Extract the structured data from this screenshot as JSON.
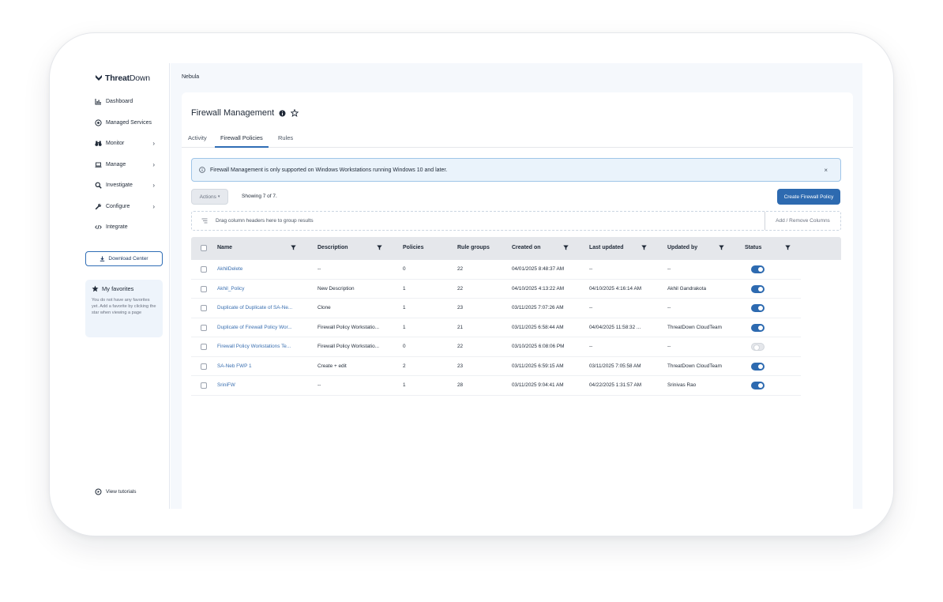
{
  "brand": {
    "name_bold": "Threat",
    "name_regular": "Down"
  },
  "sidebar": {
    "items": [
      {
        "label": "Dashboard",
        "icon": "bar-chart-icon",
        "has_chevron": false
      },
      {
        "label": "Managed Services",
        "icon": "target-icon",
        "has_chevron": false
      },
      {
        "label": "Monitor",
        "icon": "binoculars-icon",
        "has_chevron": true
      },
      {
        "label": "Manage",
        "icon": "laptop-icon",
        "has_chevron": true
      },
      {
        "label": "Investigate",
        "icon": "search-icon",
        "has_chevron": true
      },
      {
        "label": "Configure",
        "icon": "wrench-icon",
        "has_chevron": true
      },
      {
        "label": "Integrate",
        "icon": "code-icon",
        "has_chevron": false
      }
    ],
    "download_center": "Download Center",
    "favorites": {
      "title": "My favorites",
      "text": "You do not have any favorites yet. Add a favorite by clicking the star when viewing a page"
    },
    "view_tutorials": "View tutorials"
  },
  "breadcrumb": "Nebula",
  "page": {
    "title": "Firewall Management",
    "tabs": [
      "Activity",
      "Firewall Policies",
      "Rules"
    ],
    "active_tab": "Firewall Policies",
    "banner": "Firewall Management is only supported on Windows Workstations running Windows 10 and later.",
    "banner_close": "×",
    "actions_label": "Actions",
    "showing": "Showing 7 of 7.",
    "create_button": "Create Firewall Policy",
    "group_hint": "Drag column headers here to group results",
    "add_remove_columns": "Add / Remove Columns"
  },
  "table": {
    "columns": [
      "Name",
      "Description",
      "Policies",
      "Rule groups",
      "Created on",
      "Last updated",
      "Updated by",
      "Status"
    ],
    "rows": [
      {
        "name": "AkhilDelete",
        "description": "--",
        "policies": "0",
        "rule_groups": "22",
        "created_on": "04/01/2025 8:48:37 AM",
        "last_updated": "--",
        "updated_by": "--",
        "status": true
      },
      {
        "name": "Akhil_Policy",
        "description": "New Description",
        "policies": "1",
        "rule_groups": "22",
        "created_on": "04/10/2025 4:13:22 AM",
        "last_updated": "04/10/2025 4:16:14 AM",
        "updated_by": "Akhil Gandrakota",
        "status": true
      },
      {
        "name": "Duplicate of Duplicate of SA-Ne...",
        "description": "Clone",
        "policies": "1",
        "rule_groups": "23",
        "created_on": "03/11/2025 7:07:26 AM",
        "last_updated": "--",
        "updated_by": "--",
        "status": true
      },
      {
        "name": "Duplicate of Firewall Policy Wor...",
        "description": "Firewall Policy Workstatio...",
        "policies": "1",
        "rule_groups": "21",
        "created_on": "03/11/2025 6:58:44 AM",
        "last_updated": "04/04/2025 11:58:32 ...",
        "updated_by": "ThreatDown CloudTeam",
        "status": true
      },
      {
        "name": "Firewall Policy Workstations Te...",
        "description": "Firewall Policy Workstatio...",
        "policies": "0",
        "rule_groups": "22",
        "created_on": "03/10/2025 6:08:06 PM",
        "last_updated": "--",
        "updated_by": "--",
        "status": false
      },
      {
        "name": "SA-Neb FWP 1",
        "description": "Create + edit",
        "policies": "2",
        "rule_groups": "23",
        "created_on": "03/11/2025 6:59:15 AM",
        "last_updated": "03/11/2025 7:05:58 AM",
        "updated_by": "ThreatDown CloudTeam",
        "status": true
      },
      {
        "name": "SriniFW",
        "description": "--",
        "policies": "1",
        "rule_groups": "28",
        "created_on": "03/11/2025 9:04:41 AM",
        "last_updated": "04/22/2025 1:31:57 AM",
        "updated_by": "Srinivas Rao",
        "status": true
      }
    ]
  },
  "colors": {
    "accent": "#2d6ab0",
    "banner_bg": "#eaf3fb",
    "header_bg": "#e5e7eb",
    "link": "#3a6fb0"
  }
}
